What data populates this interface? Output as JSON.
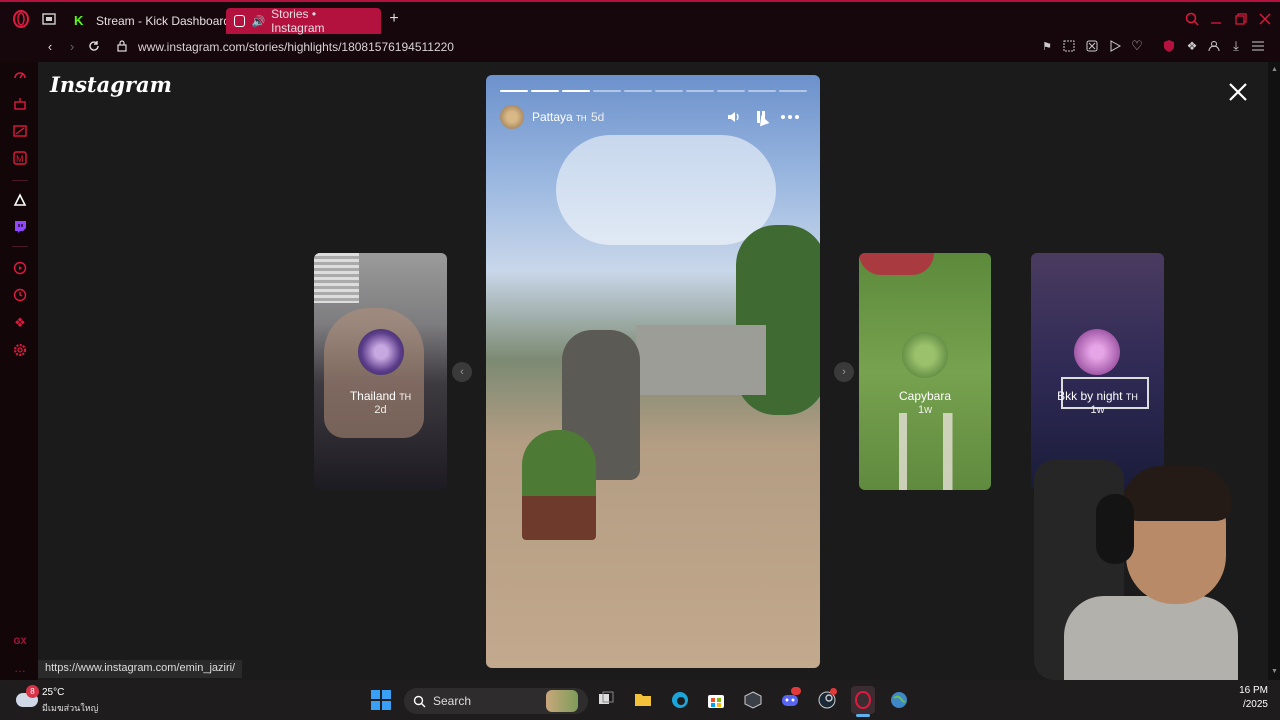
{
  "browser": {
    "tabs": [
      {
        "label": "Stream - Kick Dashboard"
      },
      {
        "label": "Stories • Instagram"
      }
    ],
    "url": "www.instagram.com/stories/highlights/18081576194511220",
    "status_url": "https://www.instagram.com/emin_jaziri/",
    "accent_color": "#b3123f"
  },
  "instagram": {
    "logo": "Instagram",
    "current_story": {
      "username": "Pattaya",
      "flag_suffix": "TH",
      "time": "5d",
      "progress_segments": 10,
      "progress_active": 3
    },
    "side_stories": [
      {
        "title": "Thailand",
        "flag_suffix": "TH",
        "age": "2d"
      },
      {
        "title": "Capybara",
        "age": "1w"
      },
      {
        "title": "Bkk by night",
        "flag_suffix": "TH",
        "age": "1w"
      }
    ]
  },
  "taskbar": {
    "weather_temp": "25°C",
    "weather_desc": "มีเมฆส่วนใหญ่",
    "weather_badge": "8",
    "search_label": "Search",
    "clock_time": "16 PM",
    "clock_date": "/2025"
  }
}
